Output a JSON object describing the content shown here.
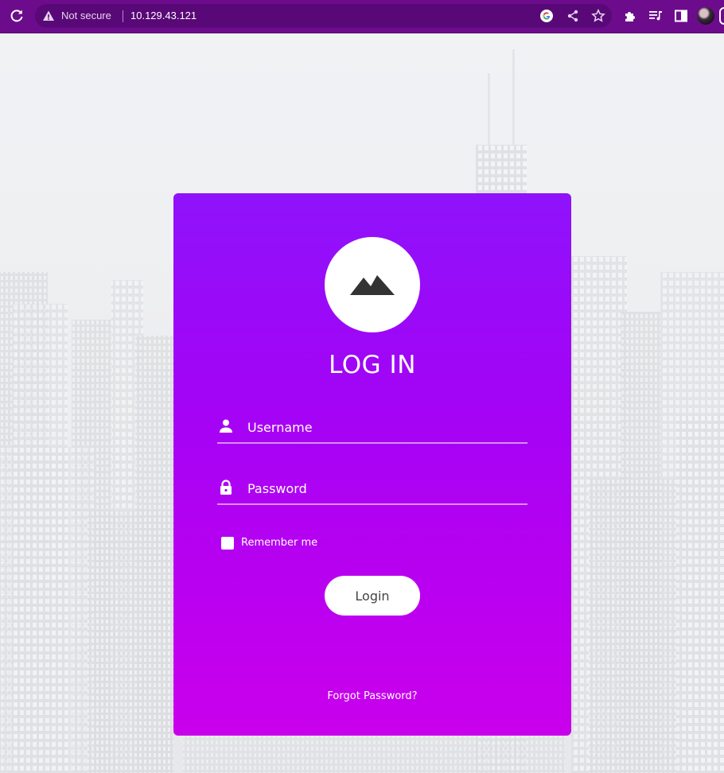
{
  "browser": {
    "security_label": "Not secure",
    "url": "10.129.43.121",
    "icons": [
      "reload-icon",
      "warning-icon",
      "google-icon",
      "share-icon",
      "star-icon",
      "extensions-icon",
      "media-icon",
      "sidepanel-icon",
      "profile-avatar"
    ]
  },
  "login": {
    "title": "LOG IN",
    "username_placeholder": "Username",
    "password_placeholder": "Password",
    "remember_label": "Remember me",
    "submit_label": "Login",
    "forgot_label": "Forgot Password?"
  },
  "colors": {
    "chrome": "#6c0c8c",
    "card_top": "#8f12fb",
    "card_bottom": "#c900ec",
    "background": "#e9ebee"
  }
}
